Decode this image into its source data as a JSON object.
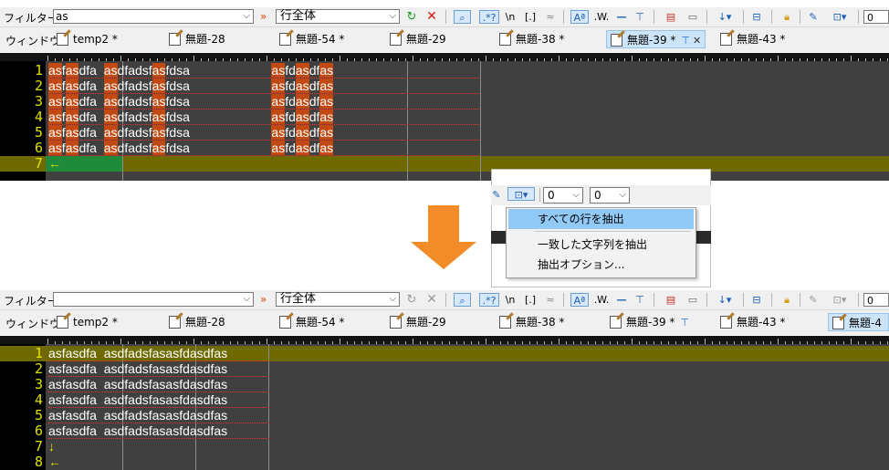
{
  "top": {
    "filter_label": "フィルター",
    "filter_value": "as",
    "scope_value": "行全体",
    "window_label": "ウィンドウ",
    "tabs": [
      {
        "label": "temp2 *"
      },
      {
        "label": "無題-28"
      },
      {
        "label": "無題-54 *"
      },
      {
        "label": "無題-29"
      },
      {
        "label": "無題-38 *"
      },
      {
        "label": "無題-39 *"
      },
      {
        "label": "無題-43 *"
      }
    ],
    "lines": [
      {
        "num": "1",
        "text": "asfasdfa  asdfadsfasfdsa                       asfdasdfas"
      },
      {
        "num": "2",
        "text": "asfasdfa  asdfadsfasfdsa                       asfdasdfas"
      },
      {
        "num": "3",
        "text": "asfasdfa  asdfadsfasfdsa                       asfdasdfas"
      },
      {
        "num": "4",
        "text": "asfasdfa  asdfadsfasfdsa                       asfdasdfas"
      },
      {
        "num": "5",
        "text": "asfasdfa  asdfadsfasfdsa                       asfdasdfas"
      },
      {
        "num": "6",
        "text": "asfasdfa  asdfadsfasfdsa                       asfdasdfas"
      },
      {
        "num": "7",
        "text": "←"
      }
    ]
  },
  "popup": {
    "select_1": "0",
    "select_2": "0",
    "menu_items": [
      "すべての行を抽出",
      "一致した文字列を抽出",
      "抽出オプション..."
    ]
  },
  "bottom": {
    "filter_label": "フィルター",
    "filter_value": "",
    "scope_value": "行全体",
    "window_label": "ウィンドウ",
    "tabs": [
      {
        "label": "temp2 *"
      },
      {
        "label": "無題-28"
      },
      {
        "label": "無題-54 *"
      },
      {
        "label": "無題-29"
      },
      {
        "label": "無題-38 *"
      },
      {
        "label": "無題-39 *"
      },
      {
        "label": "無題-43 *"
      },
      {
        "label": "無題-4"
      }
    ],
    "lines": [
      {
        "num": "1",
        "text": "asfasdfa  asdfadsfasasfdasdfas"
      },
      {
        "num": "2",
        "text": "asfasdfa  asdfadsfasasfdasdfas"
      },
      {
        "num": "3",
        "text": "asfasdfa  asdfadsfasasfdasdfas"
      },
      {
        "num": "4",
        "text": "asfasdfa  asdfadsfasasfdasdfas"
      },
      {
        "num": "5",
        "text": "asfasdfa  asdfadsfasasfdasdfas"
      },
      {
        "num": "6",
        "text": "asfasdfa  asdfadsfasasfdasdfas"
      },
      {
        "num": "7",
        "text": "↓"
      },
      {
        "num": "8",
        "text": "←"
      }
    ]
  },
  "toolbar": {
    "regex_label": ".*?",
    "newline_label": "\\n",
    "bracket_label": "[.]",
    "fuzzy_label": "≈",
    "case_label": "Aª",
    "word_label": ".W.",
    "zero_label": "0"
  },
  "colors": {
    "match_highlight": "#c24a12",
    "current_line": "#6e6a00",
    "line_number": "#e0e000",
    "menu_selected": "#91c9f7",
    "arrow": "#f28c28"
  }
}
